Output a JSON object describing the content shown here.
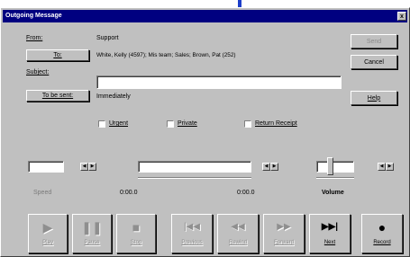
{
  "window": {
    "title": "Outgoing Message",
    "close_glyph": "x"
  },
  "header": {
    "from_label": "From:",
    "from_value": "Support",
    "to_button": "To:",
    "to_value": "White, Kelly (4597); Mis team; Sales; Brown, Pat (252)",
    "subject_label": "Subject:",
    "subject_value": "",
    "tobesent_button": "To be sent:",
    "tobesent_value": "Immediately"
  },
  "side_buttons": {
    "send": "Send",
    "cancel": "Cancel",
    "help": "Help"
  },
  "options": {
    "urgent": {
      "label": "Urgent",
      "checked": false
    },
    "private": {
      "label": "Private",
      "checked": false
    },
    "return_receipt": {
      "label": "Return Receipt",
      "checked": false
    }
  },
  "controls": {
    "speed_label": "Speed",
    "time_start": "0:00.0",
    "time_end": "0:00.0",
    "volume_label": "Volume",
    "volume_level": 0.35,
    "progress": 0
  },
  "transport": [
    {
      "id": "play",
      "label": "Play",
      "icon": "play-icon",
      "glyph": "▶",
      "enabled": false
    },
    {
      "id": "pause",
      "label": "Pause",
      "icon": "pause-icon",
      "glyph": "❚❚",
      "enabled": false
    },
    {
      "id": "stop",
      "label": "Stop",
      "icon": "stop-icon",
      "glyph": "■",
      "enabled": false
    },
    {
      "id": "previous",
      "label": "Previous",
      "icon": "previous-icon",
      "glyph": "|◀◀",
      "enabled": false
    },
    {
      "id": "rewind",
      "label": "Rewind",
      "icon": "rewind-icon",
      "glyph": "◀◀",
      "enabled": false
    },
    {
      "id": "forward",
      "label": "Forward",
      "icon": "forward-icon",
      "glyph": "▶▶",
      "enabled": false
    },
    {
      "id": "next",
      "label": "Next",
      "icon": "next-icon",
      "glyph": "▶▶|",
      "enabled": true
    },
    {
      "id": "record",
      "label": "Record",
      "icon": "record-icon",
      "glyph": "●",
      "enabled": true
    }
  ],
  "colors": {
    "accent_bar": "#1d3ec9",
    "titlebar": "#000080",
    "face": "#c0c0c0"
  }
}
